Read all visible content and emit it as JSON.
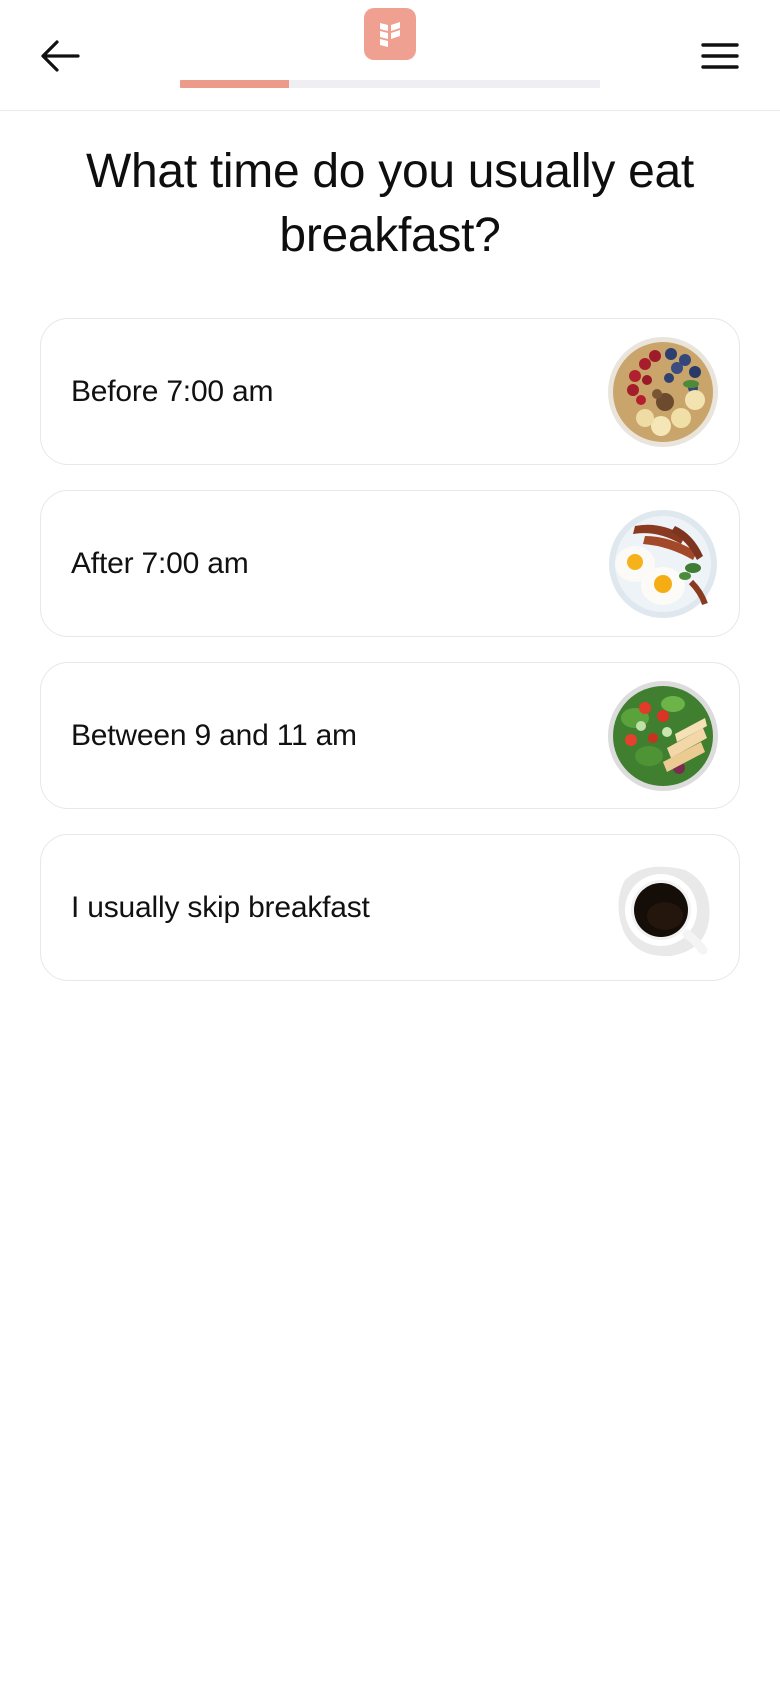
{
  "header": {
    "back_icon": "arrow-left-icon",
    "menu_icon": "hamburger-menu-icon",
    "logo_icon": "brand-logo-icon",
    "progress": 0.26,
    "progress_color": "#ec9a89",
    "brand_color": "#f0a090"
  },
  "question": {
    "title": "What time do you usually eat breakfast?"
  },
  "options": [
    {
      "label": "Before 7:00 am",
      "image": "oatmeal-berry-bowl"
    },
    {
      "label": "After 7:00 am",
      "image": "eggs-bacon-plate"
    },
    {
      "label": "Between 9 and 11 am",
      "image": "chicken-salad-bowl"
    },
    {
      "label": "I usually skip breakfast",
      "image": "black-coffee-cup"
    }
  ]
}
